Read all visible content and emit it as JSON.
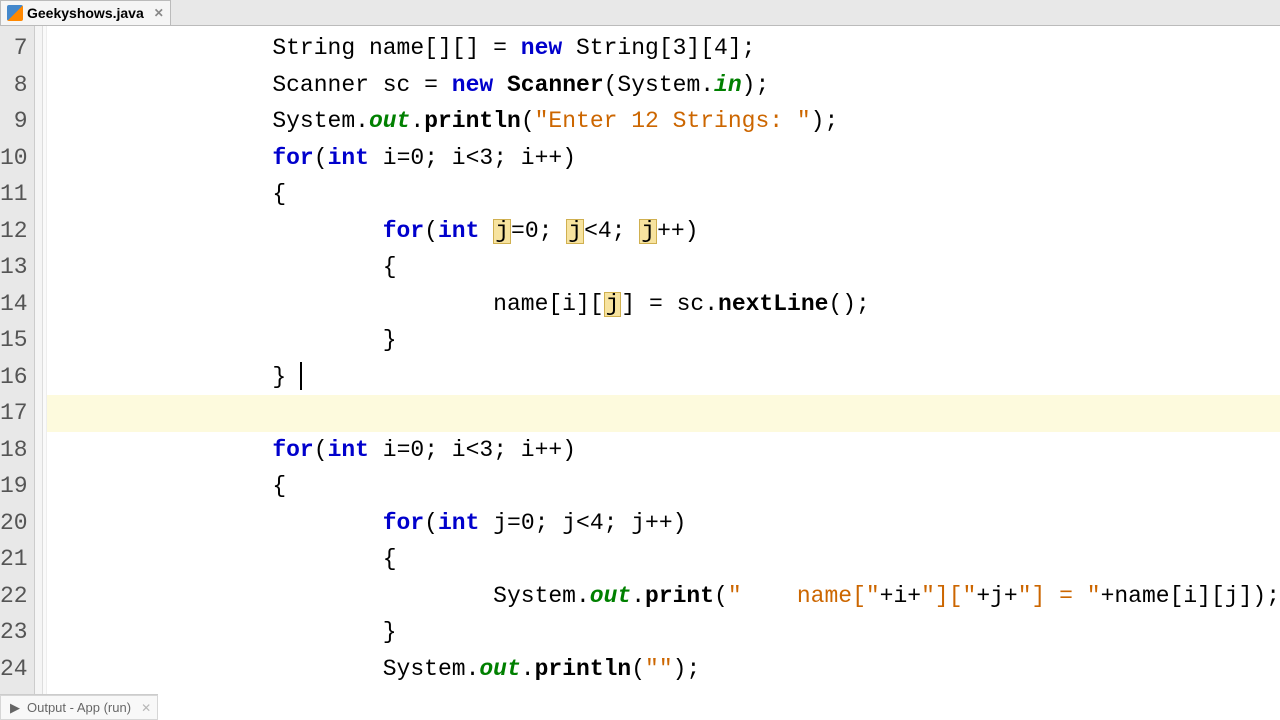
{
  "tab": {
    "filename": "Geekyshows.java"
  },
  "gutter": {
    "start": 7,
    "end": 24
  },
  "code": {
    "lines": [
      {
        "n": 7,
        "indent": 3,
        "tokens": [
          {
            "t": "String name[][] = "
          },
          {
            "t": "new",
            "c": "kw"
          },
          {
            "t": " String[3][4];"
          }
        ]
      },
      {
        "n": 8,
        "indent": 3,
        "tokens": [
          {
            "t": "Scanner sc = "
          },
          {
            "t": "new",
            "c": "kw"
          },
          {
            "t": " "
          },
          {
            "t": "Scanner",
            "c": "method"
          },
          {
            "t": "(System."
          },
          {
            "t": "in",
            "c": "field"
          },
          {
            "t": ");"
          }
        ]
      },
      {
        "n": 9,
        "indent": 3,
        "tokens": [
          {
            "t": "System."
          },
          {
            "t": "out",
            "c": "field"
          },
          {
            "t": "."
          },
          {
            "t": "println",
            "c": "method"
          },
          {
            "t": "("
          },
          {
            "t": "\"Enter 12 Strings: \"",
            "c": "str"
          },
          {
            "t": ");"
          }
        ]
      },
      {
        "n": 10,
        "indent": 3,
        "tokens": [
          {
            "t": "for",
            "c": "kw"
          },
          {
            "t": "("
          },
          {
            "t": "int",
            "c": "kw"
          },
          {
            "t": " i=0; i<3; i++)"
          }
        ]
      },
      {
        "n": 11,
        "indent": 3,
        "tokens": [
          {
            "t": "{"
          }
        ]
      },
      {
        "n": 12,
        "indent": 4,
        "tokens": [
          {
            "t": "for",
            "c": "kw"
          },
          {
            "t": "("
          },
          {
            "t": "int",
            "c": "kw"
          },
          {
            "t": " "
          },
          {
            "t": "j",
            "c": "hl-j"
          },
          {
            "t": "=0; "
          },
          {
            "t": "j",
            "c": "hl-j"
          },
          {
            "t": "<4; "
          },
          {
            "t": "j",
            "c": "hl-j"
          },
          {
            "t": "++)"
          }
        ]
      },
      {
        "n": 13,
        "indent": 4,
        "tokens": [
          {
            "t": "{"
          }
        ]
      },
      {
        "n": 14,
        "indent": 5,
        "tokens": [
          {
            "t": "name[i]["
          },
          {
            "t": "j",
            "c": "hl-j"
          },
          {
            "t": "] = sc."
          },
          {
            "t": "nextLine",
            "c": "method"
          },
          {
            "t": "();"
          }
        ]
      },
      {
        "n": 15,
        "indent": 4,
        "tokens": [
          {
            "t": "}"
          }
        ]
      },
      {
        "n": 16,
        "indent": 3,
        "tokens": [
          {
            "t": "} "
          },
          {
            "t": "",
            "cursor": true
          }
        ]
      },
      {
        "n": 17,
        "indent": 3,
        "highlighted": true,
        "tokens": [
          {
            "t": ""
          }
        ]
      },
      {
        "n": 18,
        "indent": 3,
        "tokens": [
          {
            "t": "for",
            "c": "kw"
          },
          {
            "t": "("
          },
          {
            "t": "int",
            "c": "kw"
          },
          {
            "t": " i=0; i<3; i++)"
          }
        ]
      },
      {
        "n": 19,
        "indent": 3,
        "tokens": [
          {
            "t": "{"
          }
        ]
      },
      {
        "n": 20,
        "indent": 4,
        "tokens": [
          {
            "t": "for",
            "c": "kw"
          },
          {
            "t": "("
          },
          {
            "t": "int",
            "c": "kw"
          },
          {
            "t": " j=0; j<4; j++)"
          }
        ]
      },
      {
        "n": 21,
        "indent": 4,
        "tokens": [
          {
            "t": "{"
          }
        ]
      },
      {
        "n": 22,
        "indent": 5,
        "tokens": [
          {
            "t": "System."
          },
          {
            "t": "out",
            "c": "field"
          },
          {
            "t": "."
          },
          {
            "t": "print",
            "c": "method"
          },
          {
            "t": "("
          },
          {
            "t": "\"    name[\"",
            "c": "str"
          },
          {
            "t": "+i+"
          },
          {
            "t": "\"][\"",
            "c": "str"
          },
          {
            "t": "+j+"
          },
          {
            "t": "\"] = \"",
            "c": "str"
          },
          {
            "t": "+name[i][j]);"
          }
        ]
      },
      {
        "n": 23,
        "indent": 4,
        "tokens": [
          {
            "t": "}"
          }
        ]
      },
      {
        "n": 24,
        "indent": 4,
        "tokens": [
          {
            "t": "System."
          },
          {
            "t": "out",
            "c": "field"
          },
          {
            "t": "."
          },
          {
            "t": "println",
            "c": "method"
          },
          {
            "t": "("
          },
          {
            "t": "\"\"",
            "c": "str"
          },
          {
            "t": ");"
          }
        ]
      }
    ]
  },
  "bottom_tab": {
    "label": "Output - App (run)"
  }
}
